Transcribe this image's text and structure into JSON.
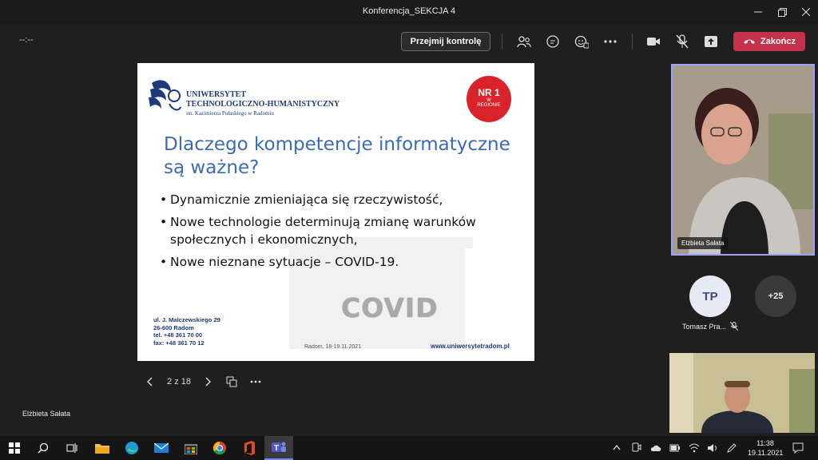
{
  "window": {
    "title": "Konferencja_SEKCJA 4"
  },
  "toolbar": {
    "timer": "--:--",
    "take_control_label": "Przejmij kontrolę",
    "hangup_label": "Zakończ"
  },
  "slide": {
    "university_line1": "UNIWERSYTET",
    "university_line2": "TECHNOLOGICZNO-HUMANISTYCZNY",
    "university_sub": "im. Kazimierza Pułaskiego w Radomiu",
    "badge_nr": "NR 1",
    "badge_w": "W",
    "badge_regionie": "REGIONIE",
    "title_line1": "Dlaczego kompetencje informatyczne",
    "title_line2": "są ważne?",
    "bullets": [
      "Dynamicznie zmieniająca się rzeczywistość,",
      "Nowe technologie determinują zmianę warunków społecznych i ekonomicznych,",
      "Nowe nieznane sytuacje – COVID-19."
    ],
    "covid_logo": "COVID",
    "address": [
      "ul. J. Malczewskiego 29",
      "26-600 Radom",
      "tel. +48 361 70 00",
      "fax: +48 361 70 12"
    ],
    "place_date": "Radom, 18-19.11.2021",
    "website": "www.uniwersytetradom.pl"
  },
  "slide_nav": {
    "counter": "2 z 18"
  },
  "presenter": {
    "name": "Elżbieta Sałata"
  },
  "participants": {
    "video1_name": "Elżbieta Sałata",
    "tp_initials": "TP",
    "tp_name": "Tomasz Pra...",
    "more_count": "+25"
  },
  "taskbar": {
    "time": "11:38",
    "date": "19.11.2021"
  },
  "colors": {
    "hangup": "#c4314b",
    "active_border": "#9ea2ff",
    "slide_title": "#3b6bb6",
    "university_blue": "#1f3a7a",
    "badge_red": "#d9222a"
  }
}
